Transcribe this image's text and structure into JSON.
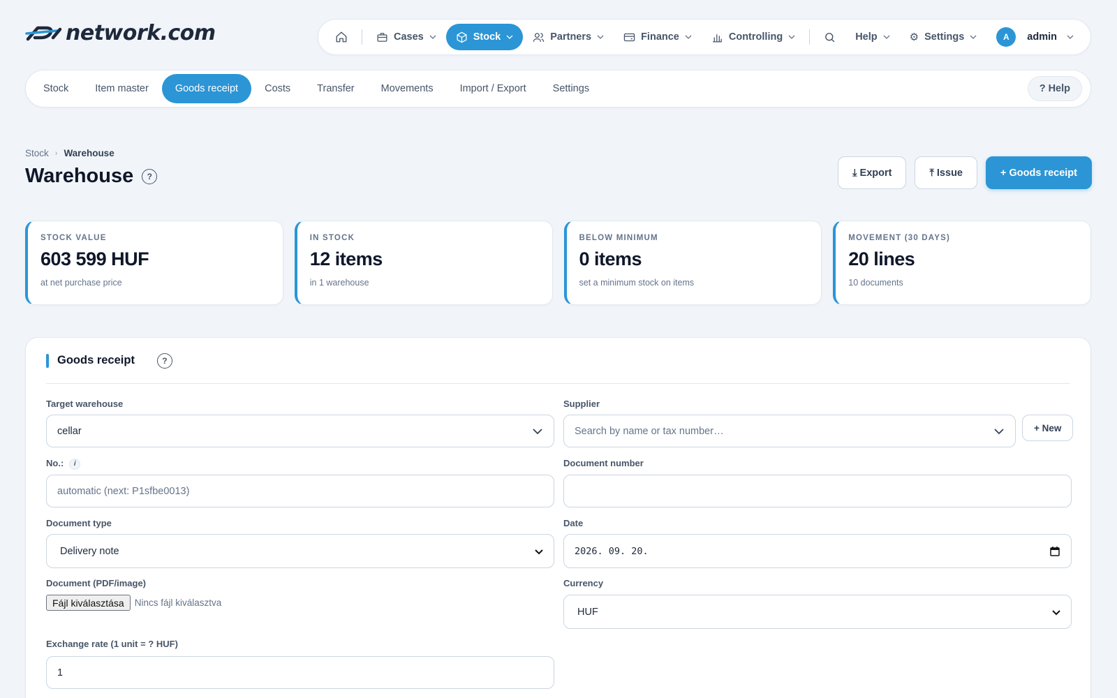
{
  "brand": {
    "logo_text": "network.com"
  },
  "topnav": {
    "items": [
      {
        "label": "Cases",
        "icon": "briefcase-icon"
      },
      {
        "label": "Stock",
        "icon": "box-icon",
        "active": true
      },
      {
        "label": "Partners",
        "icon": "users-icon"
      },
      {
        "label": "Finance",
        "icon": "wallet-icon"
      },
      {
        "label": "Controlling",
        "icon": "bar-chart-icon"
      }
    ],
    "help_label": "Help",
    "settings_label": "Settings",
    "user_initial": "A",
    "user_name": "admin"
  },
  "subnav": {
    "items": [
      "Stock",
      "Item master",
      "Goods receipt",
      "Costs",
      "Transfer",
      "Movements",
      "Import / Export",
      "Settings"
    ],
    "active": "Goods receipt",
    "help_label": "? Help"
  },
  "breadcrumb": {
    "root": "Stock",
    "current": "Warehouse"
  },
  "page": {
    "title": "Warehouse",
    "help_glyph": "?",
    "actions": {
      "export": "⤓ Export",
      "issue": "⤒ Issue",
      "goods_receipt": "+ Goods receipt"
    }
  },
  "kpis": [
    {
      "label": "STOCK VALUE",
      "value": "603 599 HUF",
      "sub": "at net purchase price"
    },
    {
      "label": "IN STOCK",
      "value": "12 items",
      "sub": "in 1 warehouse"
    },
    {
      "label": "BELOW MINIMUM",
      "value": "0 items",
      "sub": "set a minimum stock on items"
    },
    {
      "label": "MOVEMENT (30 DAYS)",
      "value": "20 lines",
      "sub": "10 documents"
    }
  ],
  "form": {
    "title": "Goods receipt",
    "help_glyph": "?",
    "target_warehouse": {
      "label": "Target warehouse",
      "value": "cellar"
    },
    "supplier": {
      "label": "Supplier",
      "placeholder": "Search by name or tax number…",
      "new_label": "+ New"
    },
    "number": {
      "label": "No.:",
      "info_glyph": "i",
      "placeholder": "automatic (next: P1sfbe0013)"
    },
    "document_number": {
      "label": "Document number",
      "value": ""
    },
    "document_type": {
      "label": "Document type",
      "value": "Delivery note"
    },
    "date": {
      "label": "Date",
      "value": "2026. 09. 20."
    },
    "document_file": {
      "label": "Document (PDF/image)",
      "button_label": "Fájl kiválasztása",
      "status": "Nincs fájl kiválasztva"
    },
    "currency": {
      "label": "Currency",
      "value": "HUF"
    },
    "exchange_rate": {
      "label": "Exchange rate (1 unit = ? HUF)",
      "value": "1"
    }
  },
  "colors": {
    "accent": "#2b95d6",
    "background": "#f1f5f9",
    "text": "#0f172a"
  }
}
